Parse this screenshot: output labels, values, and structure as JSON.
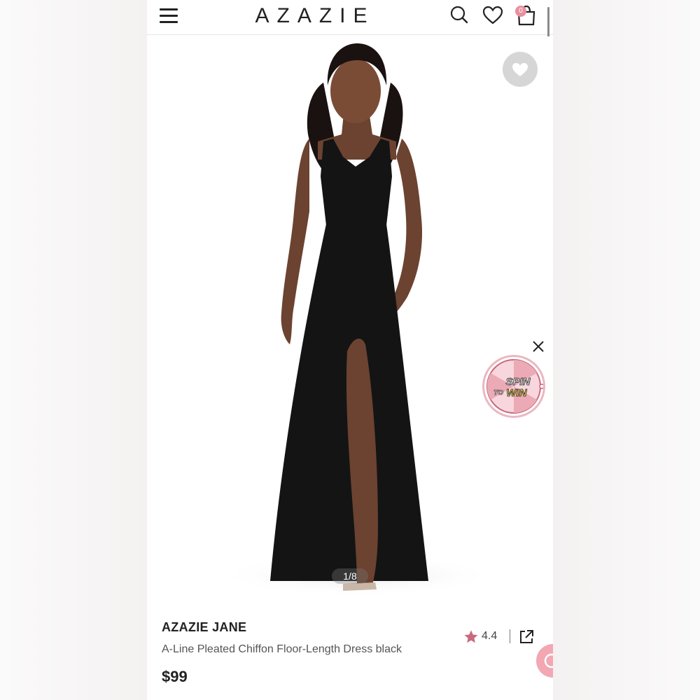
{
  "header": {
    "logo": "AZAZIE",
    "cart_count": "0"
  },
  "gallery": {
    "counter": "1/8",
    "promo_line1": "SPIN",
    "promo_line2": "TO",
    "promo_line3": "WIN"
  },
  "product": {
    "brand": "AZAZIE JANE",
    "name": "A-Line Pleated Chiffon Floor-Length Dress black",
    "price": "$99",
    "rating": "4.4"
  },
  "colors": {
    "accent_pink": "#e88fa0",
    "rating_star": "#c86a7d",
    "dress": "#141414",
    "skin": "#6b4330"
  },
  "icons": {
    "menu": "hamburger-icon",
    "search": "search-icon",
    "wishlist": "heart-icon",
    "cart": "shopping-bag-icon",
    "favorite": "heart-icon",
    "close": "close-icon",
    "rating": "star-icon",
    "share": "share-external-icon",
    "chat": "chat-icon"
  }
}
